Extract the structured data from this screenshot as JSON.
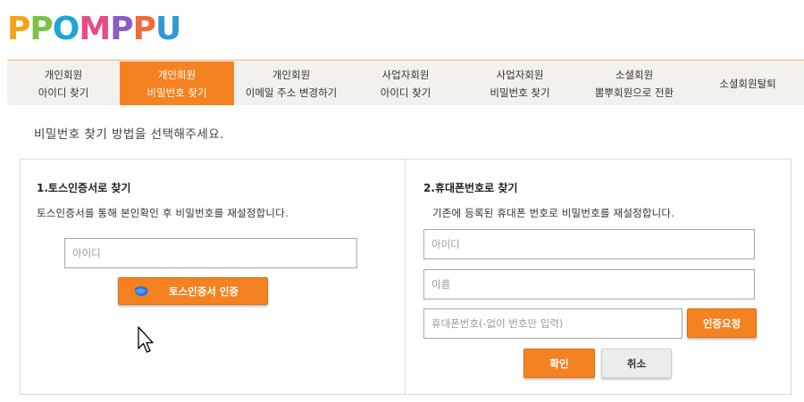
{
  "logo": {
    "text": "PPOMPPU",
    "letters": [
      {
        "ch": "P",
        "color": "#f7a21b"
      },
      {
        "ch": "P",
        "color": "#7cc242"
      },
      {
        "ch": "O",
        "color": "#1fa4d8"
      },
      {
        "ch": "M",
        "color": "#e84a8a"
      },
      {
        "ch": "P",
        "color": "#8a5cc5"
      },
      {
        "ch": "P",
        "color": "#f26a3c"
      },
      {
        "ch": "U",
        "color": "#2c9ad6"
      }
    ]
  },
  "tabs": [
    {
      "line1": "개인회원",
      "line2": "아이디 찾기",
      "active": false
    },
    {
      "line1": "개인회원",
      "line2": "비밀번호 찾기",
      "active": true
    },
    {
      "line1": "개인회원",
      "line2": "이메일 주소 변경하기",
      "active": false
    },
    {
      "line1": "사업자회원",
      "line2": "아이디 찾기",
      "active": false
    },
    {
      "line1": "사업자회원",
      "line2": "비밀번호 찾기",
      "active": false
    },
    {
      "line1": "소셜회원",
      "line2": "뽐뿌회원으로 전환",
      "active": false
    },
    {
      "line1": "소셜회원탈퇴",
      "line2": "",
      "active": false
    }
  ],
  "instruction": "비밀번호 찾기 방법을 선택해주세요.",
  "toss_section": {
    "title": "1.토스인증서로 찾기",
    "description": "토스인증서를 통해 본인확인 후 비밀번호를 재설정합니다.",
    "id_placeholder": "아이디",
    "button_label": "토스인증서 인증"
  },
  "phone_section": {
    "title": "2.휴대폰번호로 찾기",
    "description": "기존에 등록된 휴대폰 번호로 비밀번호를 재설정합니다.",
    "id_placeholder": "아이디",
    "name_placeholder": "이름",
    "phone_placeholder": "휴대폰번호(-없이 번호만 입력)",
    "request_button": "인증요청",
    "confirm_button": "확인",
    "cancel_button": "취소"
  },
  "colors": {
    "accent": "#f58220",
    "tab_bg": "#f3f1ee"
  }
}
